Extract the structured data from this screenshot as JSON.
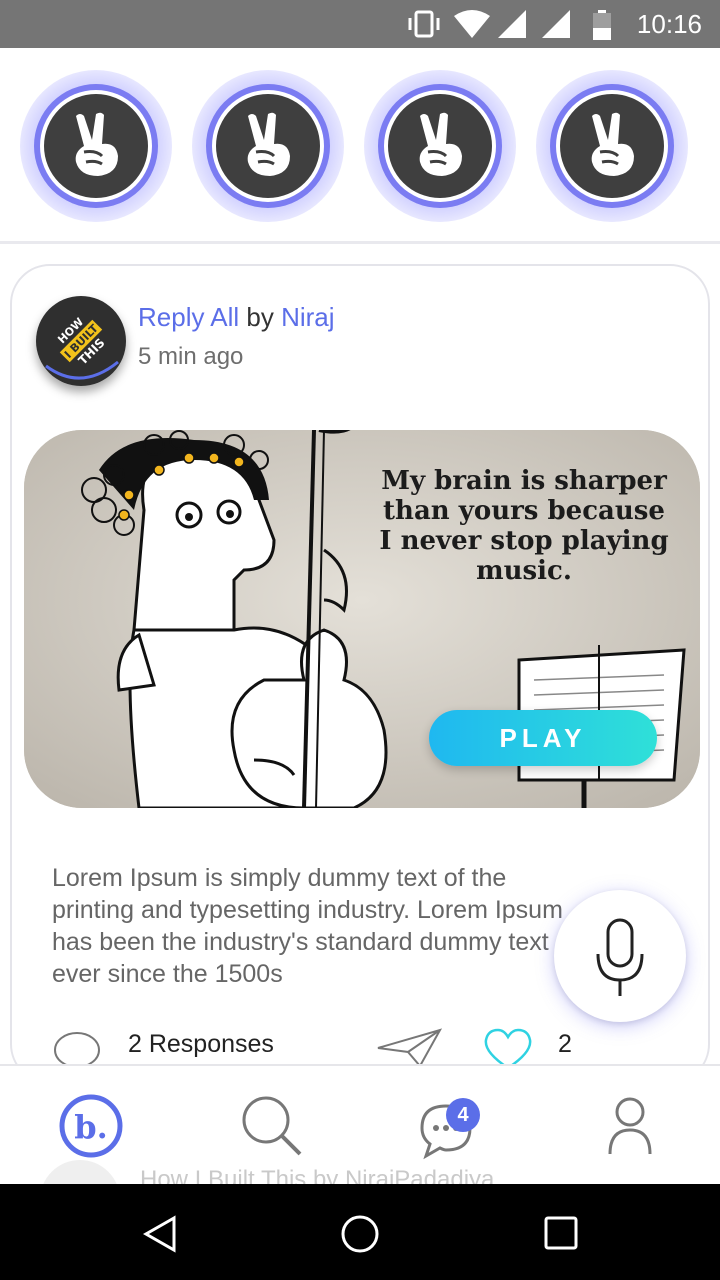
{
  "status_bar": {
    "time": "10:16",
    "icons": [
      "vibrate-icon",
      "wifi-icon",
      "signal-icon",
      "signal-icon",
      "battery-icon"
    ]
  },
  "stories": [
    {
      "icon": "peace-hand-icon"
    },
    {
      "icon": "peace-hand-icon"
    },
    {
      "icon": "peace-hand-icon"
    },
    {
      "icon": "peace-hand-icon"
    }
  ],
  "post": {
    "podcast": "Reply All",
    "by": "by",
    "author": "Niraj",
    "time_ago": "5 min ago",
    "avatar_text": "HOW I BUILT THIS",
    "media": {
      "quote": "My brain is sharper than yours because I never stop playing music.",
      "play_label": "PLAY"
    },
    "description": "Lorem Ipsum is simply dummy text of the printing and typesetting industry. Lorem Ipsum has been the industry's standard dummy text ever since the 1500s",
    "responses_label": "2 Responses",
    "likes": "2"
  },
  "bottom_nav": {
    "items": [
      "home-logo-icon",
      "search-icon",
      "chat-icon",
      "profile-icon"
    ],
    "chat_badge": "4",
    "next_post_preview": "How I Built This by NirajPadadiya"
  },
  "colors": {
    "accent": "#5b6ee8",
    "play_gradient_start": "#1fb8f0",
    "play_gradient_end": "#2fe0d8",
    "story_ring": "#7b7cf2"
  }
}
